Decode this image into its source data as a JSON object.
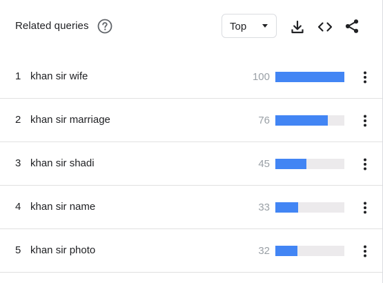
{
  "header": {
    "title": "Related queries",
    "help_icon": "help-circle-icon",
    "dropdown": {
      "selected": "Top"
    },
    "actions": [
      {
        "name": "download-icon"
      },
      {
        "name": "embed-code-icon"
      },
      {
        "name": "share-icon"
      }
    ]
  },
  "colors": {
    "bar_fill": "#4285f4",
    "bar_track": "#eceaec",
    "value_text": "#9aa0a6",
    "divider": "#e0e0e0"
  },
  "queries": [
    {
      "rank": "1",
      "query": "khan sir wife",
      "value": "100",
      "percent": 100
    },
    {
      "rank": "2",
      "query": "khan sir marriage",
      "value": "76",
      "percent": 76
    },
    {
      "rank": "3",
      "query": "khan sir shadi",
      "value": "45",
      "percent": 45
    },
    {
      "rank": "4",
      "query": "khan sir name",
      "value": "33",
      "percent": 33
    },
    {
      "rank": "5",
      "query": "khan sir photo",
      "value": "32",
      "percent": 32
    }
  ]
}
